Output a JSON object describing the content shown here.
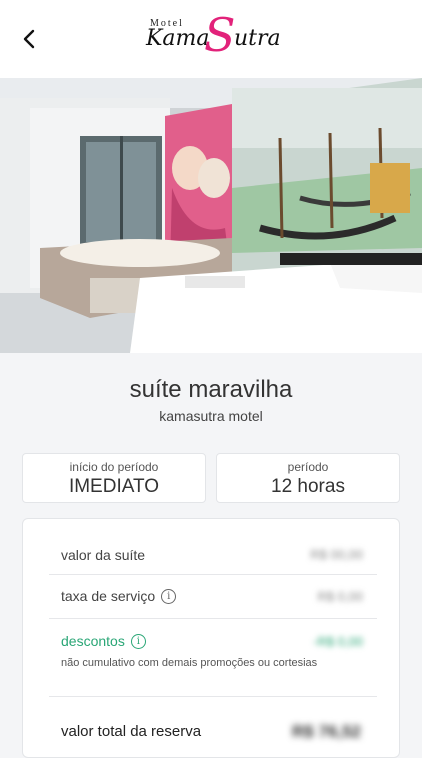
{
  "header": {
    "back_icon": "chevron-left-icon",
    "logo": {
      "small": "Motel",
      "left": "Kama",
      "s": "S",
      "right": "utra"
    }
  },
  "gallery": {
    "slide_count": 13,
    "active_index": 0
  },
  "suite": {
    "name": "suíte maravilha",
    "motel": "kamasutra motel"
  },
  "period_start": {
    "label": "início do período",
    "value": "IMEDIATO"
  },
  "period": {
    "label": "período",
    "value": "12 horas"
  },
  "pricing": {
    "suite_value_label": "valor da suíte",
    "suite_value": "R$ 00,00",
    "service_fee_label": "taxa de serviço",
    "service_fee": "R$ 0,00",
    "discounts_label": "descontos",
    "discounts_value": "-R$ 0,00",
    "discounts_note": "não cumulativo com demais promoções ou cortesias",
    "total_label": "valor total da reserva",
    "total_value": "R$ 76,52"
  },
  "colors": {
    "accent_pink": "#e2227a",
    "discount_green": "#2aa676"
  }
}
